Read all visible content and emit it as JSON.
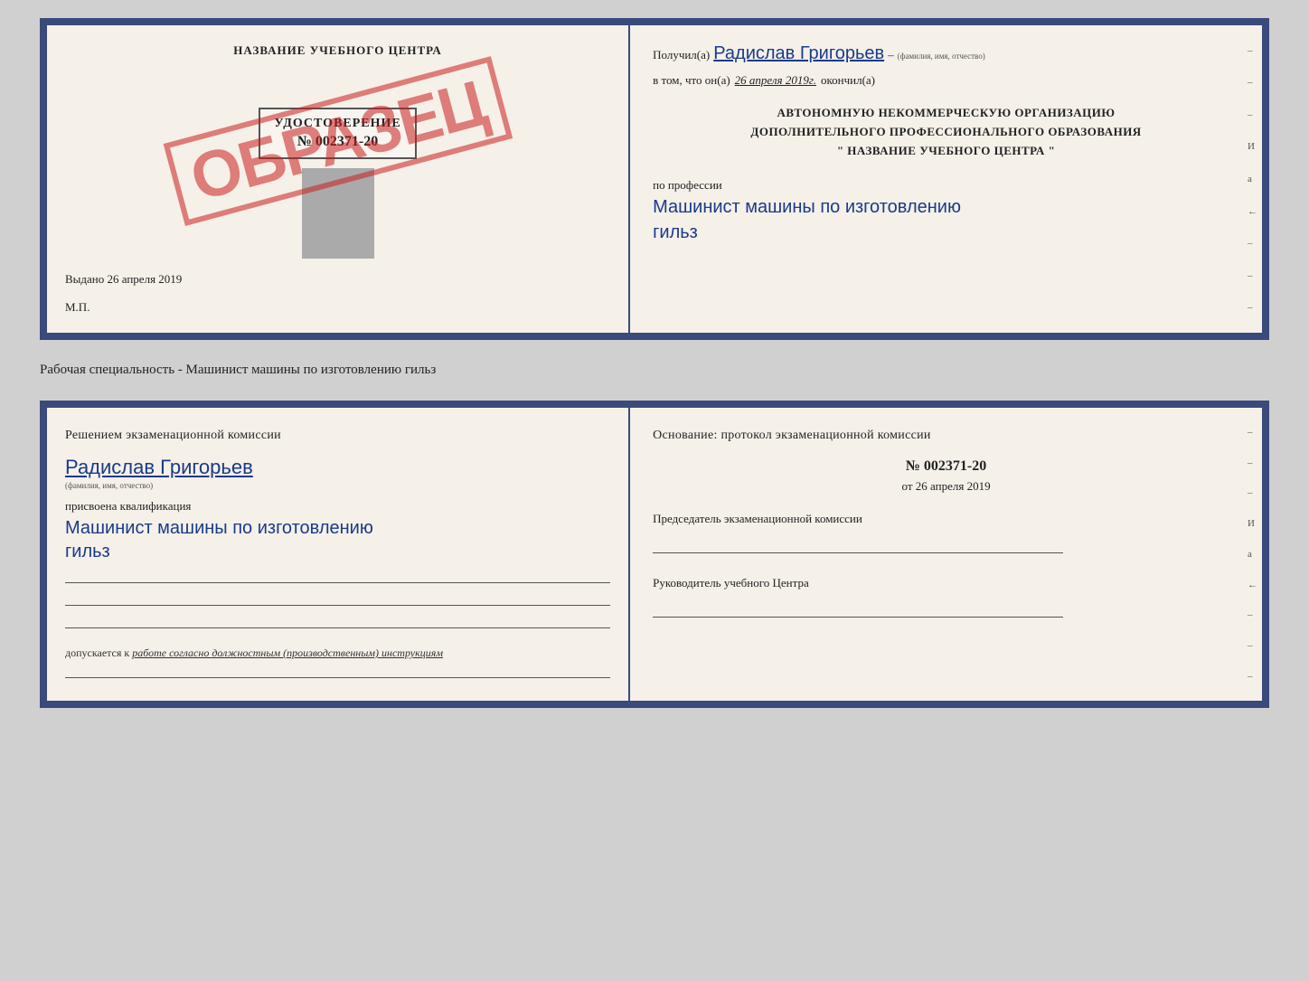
{
  "top_document": {
    "left": {
      "title": "НАЗВАНИЕ УЧЕБНОГО ЦЕНТРА",
      "stamp_text": "ОБРАЗЕЦ",
      "certificate_label": "УДОСТОВЕРЕНИЕ",
      "certificate_number": "№ 002371-20",
      "issued_label": "Выдано",
      "issued_date": "26 апреля 2019",
      "mp_label": "М.П."
    },
    "right": {
      "received_prefix": "Получил(а)",
      "recipient_name": "Радислав Григорьев",
      "fio_label": "(фамилия, имя, отчество)",
      "date_prefix": "в том, что он(а)",
      "date_value": "26 апреля 2019г.",
      "date_suffix": "окончил(а)",
      "org_line1": "АВТОНОМНУЮ НЕКОММЕРЧЕСКУЮ ОРГАНИЗАЦИЮ",
      "org_line2": "ДОПОЛНИТЕЛЬНОГО ПРОФЕССИОНАЛЬНОГО ОБРАЗОВАНИЯ",
      "org_line3": "\"   НАЗВАНИЕ УЧЕБНОГО ЦЕНТРА   \"",
      "profession_label": "по профессии",
      "profession_value": "Машинист машины по изготовлению",
      "profession_line2": "гильз",
      "side_marks": [
        "–",
        "–",
        "–",
        "И",
        "а",
        "←",
        "–",
        "–",
        "–"
      ]
    }
  },
  "caption": {
    "text": "Рабочая специальность - Машинист машины по изготовлению гильз"
  },
  "bottom_document": {
    "left": {
      "decision_text": "Решением  экзаменационной  комиссии",
      "person_name": "Радислав Григорьев",
      "fio_label": "(фамилия, имя, отчество)",
      "qualification_label": "присвоена квалификация",
      "qualification_value": "Машинист машины по изготовлению",
      "qualification_line2": "гильз",
      "allowed_prefix": "допускается к",
      "allowed_text": "работе согласно должностным (производственным) инструкциям"
    },
    "right": {
      "basis_text": "Основание: протокол экзаменационной  комиссии",
      "protocol_number": "№  002371-20",
      "date_prefix": "от",
      "date_value": "26 апреля 2019",
      "chairman_label": "Председатель экзаменационной комиссии",
      "director_label": "Руководитель учебного Центра",
      "side_marks": [
        "–",
        "–",
        "–",
        "И",
        "а",
        "←",
        "–",
        "–",
        "–"
      ]
    }
  }
}
